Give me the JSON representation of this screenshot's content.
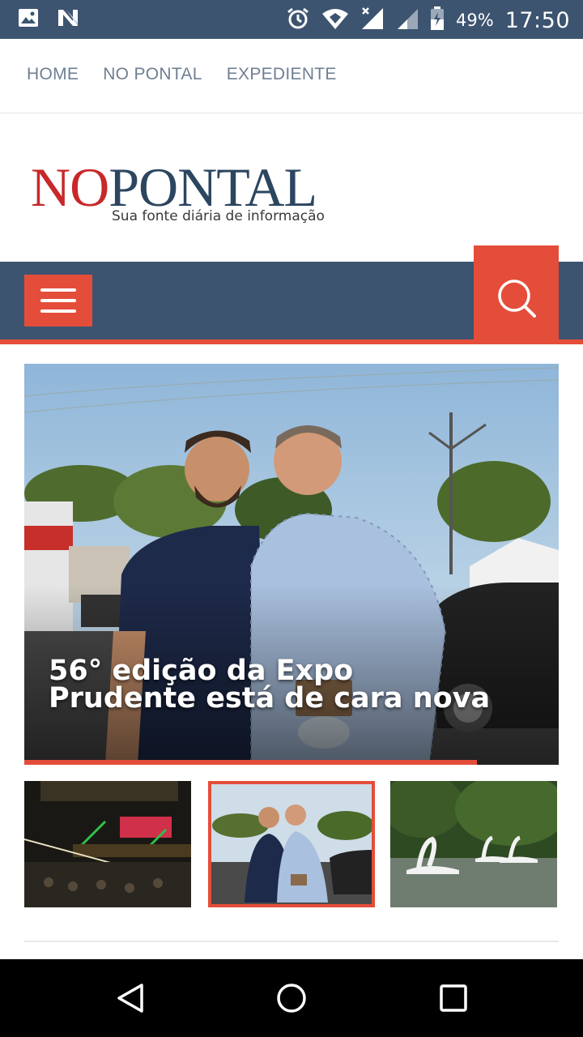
{
  "status_bar": {
    "battery_percent": "49%",
    "time": "17:50",
    "icons": [
      "image-icon",
      "n-app-icon",
      "alarm-icon",
      "wifi-icon",
      "signal-x-icon",
      "signal-icon",
      "battery-icon"
    ]
  },
  "top_nav": {
    "items": [
      {
        "label": "HOME"
      },
      {
        "label": "NO PONTAL"
      },
      {
        "label": "EXPEDIENTE"
      }
    ]
  },
  "logo": {
    "word_no": "NO",
    "word_pontal": "PONTAL",
    "tagline": "Sua fonte diária de informação"
  },
  "nav_bar": {
    "menu_icon": "hamburger-icon",
    "search_icon": "search-icon"
  },
  "hero": {
    "title": "56° edição da Expo Prudente está de cara nova",
    "slide_progress": 0.847
  },
  "thumbnails": [
    {
      "name": "concert-stage"
    },
    {
      "name": "two-men-award",
      "active": true
    },
    {
      "name": "swan-pedal-boats"
    }
  ],
  "colors": {
    "primary_dark": "#3d5470",
    "accent_red": "#e44d3a"
  },
  "bottom_nav": {
    "icons": [
      "back-icon",
      "home-icon",
      "recents-icon"
    ]
  }
}
